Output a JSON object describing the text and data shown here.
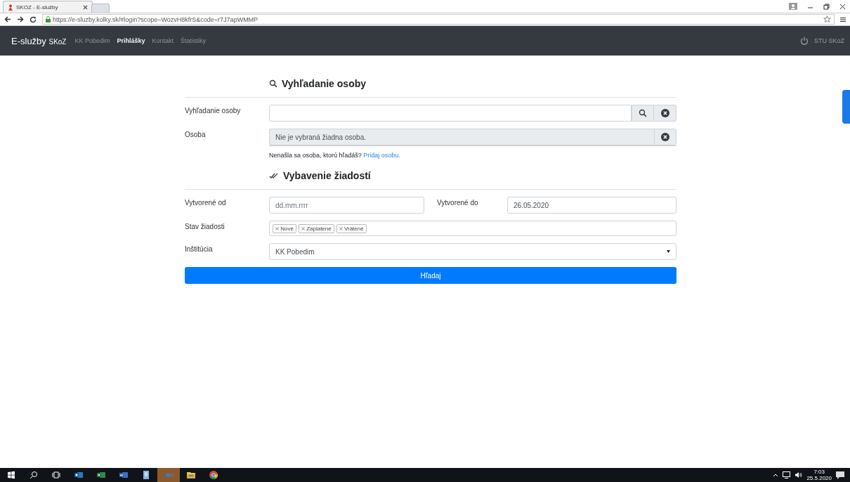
{
  "browser": {
    "tab_title": "SKOZ - E-služby",
    "url": "https://e-sluzby.kolky.sk/#login?scope=WozvH8kfrS&code=r7J7apWMMP"
  },
  "navbar": {
    "brand": "E-služby",
    "brand_suffix": "SKoZ",
    "items": [
      {
        "label": "KK Pobedim",
        "selected": false
      },
      {
        "label": "Prihlášky",
        "selected": true
      },
      {
        "label": "Kontakt",
        "selected": false
      },
      {
        "label": "Štatistiky",
        "selected": false
      }
    ],
    "user": "STU SKoZ"
  },
  "person_section": {
    "title": "Vyhľadanie osoby",
    "search_label": "Vyhľadanie osoby",
    "person_label": "Osoba",
    "person_value": "Nie je vybraná žiadna osoba.",
    "hint": "Nenašla sa osoba, ktorú hľadáš?",
    "hint_link": "Pridaj osobu."
  },
  "filter_section": {
    "title": "Vybavenie žiadostí",
    "from_label": "Vytvorené od",
    "from_placeholder": "dd.mm.rrrr",
    "to_label": "Vytvorené do",
    "to_value": "26.05.2020",
    "status_label": "Stav žiadosti",
    "status_tags": [
      "Nové",
      "Zaplatené",
      "Vrátené"
    ],
    "institution_label": "Inštitúcia",
    "institution_value": "KK Pobedim",
    "submit": "Hľadaj"
  },
  "taskbar": {
    "apps": [
      {
        "kind": "outlook",
        "active": false
      },
      {
        "kind": "excel",
        "active": false
      },
      {
        "kind": "word",
        "active": false
      },
      {
        "kind": "notes",
        "active": false
      },
      {
        "kind": "app",
        "active": true
      },
      {
        "kind": "explorer",
        "active": false
      },
      {
        "kind": "chrome",
        "active": false
      }
    ],
    "time": "7:03",
    "date": "25.5.2020"
  }
}
